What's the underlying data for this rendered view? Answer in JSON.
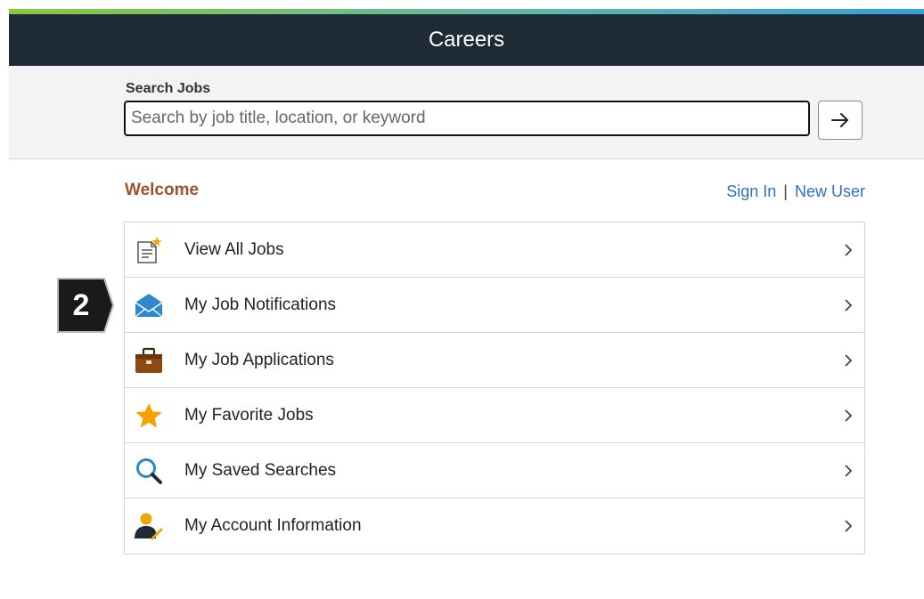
{
  "header": {
    "title": "Careers"
  },
  "search": {
    "label": "Search Jobs",
    "placeholder": "Search by job title, location, or keyword",
    "value": ""
  },
  "welcome": {
    "title": "Welcome"
  },
  "auth": {
    "sign_in": "Sign In",
    "separator": "|",
    "new_user": "New User"
  },
  "menu": {
    "items": [
      {
        "label": "View All Jobs",
        "icon": "new-document-icon"
      },
      {
        "label": "My Job Notifications",
        "icon": "envelope-icon"
      },
      {
        "label": "My Job Applications",
        "icon": "briefcase-icon"
      },
      {
        "label": "My Favorite Jobs",
        "icon": "star-icon"
      },
      {
        "label": "My Saved Searches",
        "icon": "magnifier-icon"
      },
      {
        "label": "My Account Information",
        "icon": "user-edit-icon"
      }
    ]
  },
  "callout": {
    "step": "2"
  },
  "colors": {
    "header_bg": "#1f2a37",
    "welcome": "#a0522d",
    "link": "#2f6fbf"
  }
}
